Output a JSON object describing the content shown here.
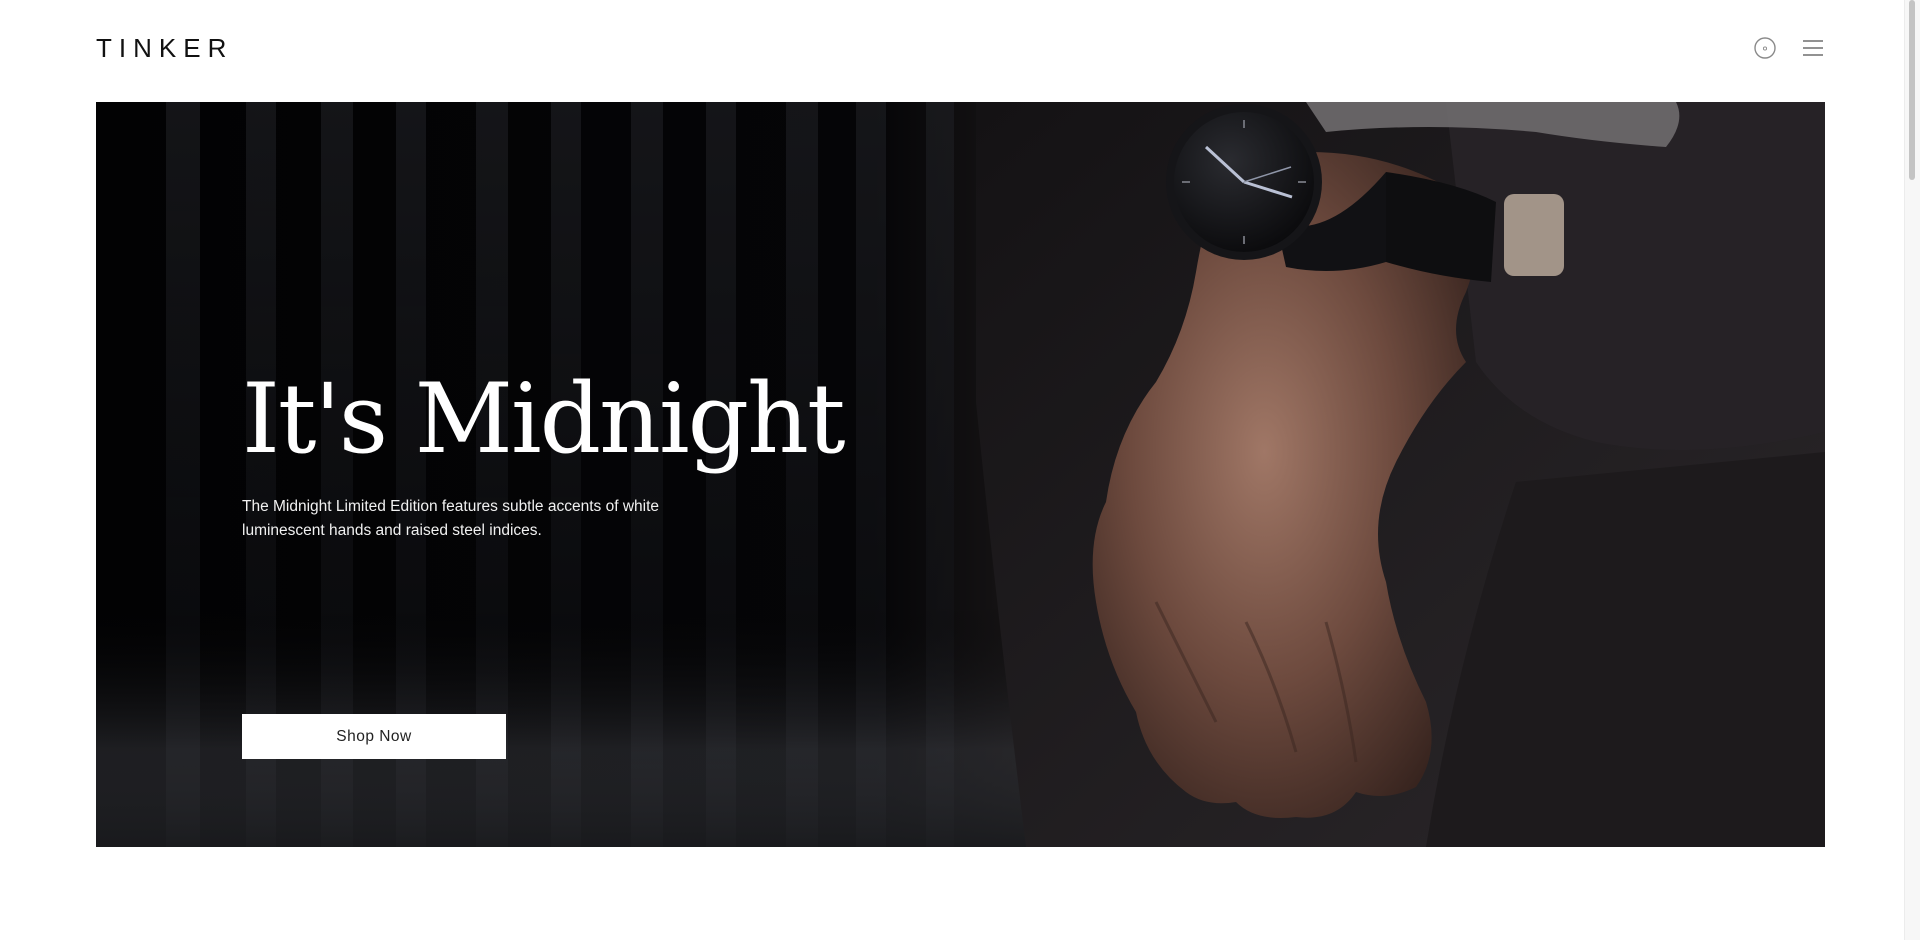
{
  "header": {
    "logo_text": "TINKER",
    "cart_icon": "cart-circle-icon",
    "menu_icon": "hamburger-menu-icon"
  },
  "hero": {
    "title": "It's Midnight",
    "description": "The Midnight Limited Edition features subtle accents of white luminescent hands and raised steel indices.",
    "cta_label": "Shop Now",
    "image_subject": "hand wearing black wristwatch"
  },
  "colors": {
    "text_dark": "#111111",
    "hero_background": "#050505",
    "button_bg": "#ffffff",
    "hero_text": "#ffffff"
  }
}
